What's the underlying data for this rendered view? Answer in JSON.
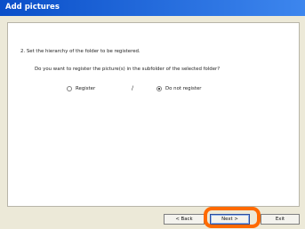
{
  "window": {
    "title": "Add pictures"
  },
  "wizard": {
    "step_text": "2. Set the hierarchy of the folder to be registered.",
    "question": "Do you want to register the picture(s) in the subfolder of the selected folder?",
    "options": [
      {
        "label": "Register",
        "selected": false
      },
      {
        "label": "Do not register",
        "selected": true
      }
    ],
    "separator": "/"
  },
  "buttons": {
    "back": "< Back",
    "next": "Next >",
    "exit": "Exit"
  },
  "colors": {
    "title_bar": "#0a4fc9",
    "highlight": "#ff6a00",
    "background": "#ece9d8"
  }
}
